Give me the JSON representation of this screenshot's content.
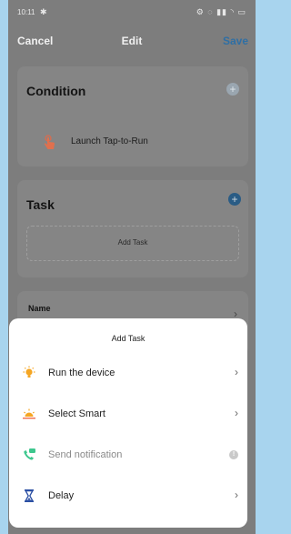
{
  "status_bar": {
    "time": "10:11",
    "bluetooth": "✱",
    "icons": "⚙ ◌ ▮▮ ◝ ▭"
  },
  "nav": {
    "cancel": "Cancel",
    "title": "Edit",
    "save": "Save"
  },
  "condition": {
    "title": "Condition",
    "add": "+",
    "item": "Launch Tap-to-Run",
    "item_icon": "hand-tap-icon"
  },
  "task": {
    "title": "Task",
    "add": "+",
    "add_task_label": "Add Task"
  },
  "name_section": {
    "label": "Name",
    "chevron": "›"
  },
  "sheet": {
    "title": "Add Task",
    "items": [
      {
        "label": "Run the device",
        "icon": "bulb-icon",
        "trailing": "›",
        "enabled": true
      },
      {
        "label": "Select Smart",
        "icon": "sunrise-icon",
        "trailing": "›",
        "enabled": true
      },
      {
        "label": "Send notification",
        "icon": "notification-icon",
        "trailing": "!",
        "enabled": false
      },
      {
        "label": "Delay",
        "icon": "hourglass-icon",
        "trailing": "›",
        "enabled": true
      }
    ]
  },
  "colors": {
    "accent_blue": "#2f6fa4",
    "overlay_gray": "#7d7d7d",
    "background": "#a8d4ee",
    "icon_orange": "#f5a623",
    "icon_green": "#3ec78e",
    "icon_navy": "#2b4fa3"
  }
}
